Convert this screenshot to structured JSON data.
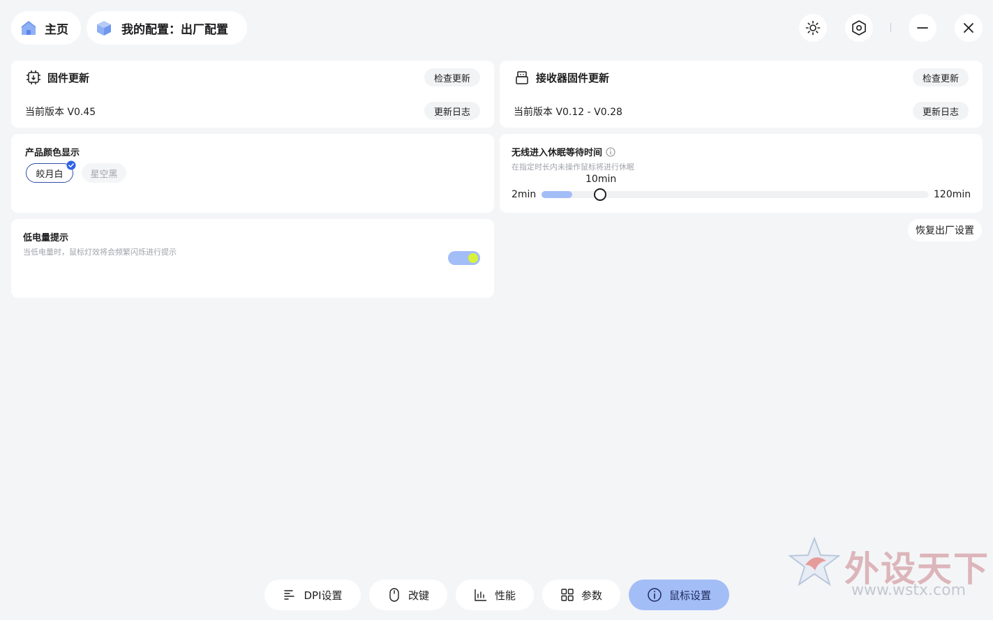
{
  "header": {
    "home_label": "主页",
    "config_label": "我的配置：出厂配置"
  },
  "firmware": {
    "title": "固件更新",
    "check_label": "检查更新",
    "version": "当前版本 V0.45",
    "log_label": "更新日志"
  },
  "receiver": {
    "title": "接收器固件更新",
    "check_label": "检查更新",
    "version": "当前版本 V0.12 - V0.28",
    "log_label": "更新日志"
  },
  "color": {
    "title": "产品颜色显示",
    "options": [
      "皎月白",
      "星空黑"
    ],
    "selected": "皎月白"
  },
  "sleep": {
    "title": "无线进入休眠等待时间",
    "desc": "在指定时长内未操作鼠标将进行休眠",
    "min_label": "2min",
    "max_label": "120min",
    "value_label": "10min",
    "min": 2,
    "max": 120,
    "value": 10
  },
  "reset_label": "恢复出厂设置",
  "battery": {
    "title": "低电量提示",
    "desc": "当低电量时，鼠标灯效将会频繁闪烁进行提示",
    "enabled": true
  },
  "tabs": [
    {
      "label": "DPI设置",
      "icon": "dpi-icon"
    },
    {
      "label": "改键",
      "icon": "mouse-icon"
    },
    {
      "label": "性能",
      "icon": "chart-icon"
    },
    {
      "label": "参数",
      "icon": "grid-icon"
    },
    {
      "label": "鼠标设置",
      "icon": "info-icon"
    }
  ],
  "watermark": {
    "text": "外设天下",
    "url": "www.wstx.com"
  },
  "colors": {
    "accent": "#a3bdf7",
    "toggle_knob": "#d8f23a",
    "check_badge": "#2f62e6"
  }
}
